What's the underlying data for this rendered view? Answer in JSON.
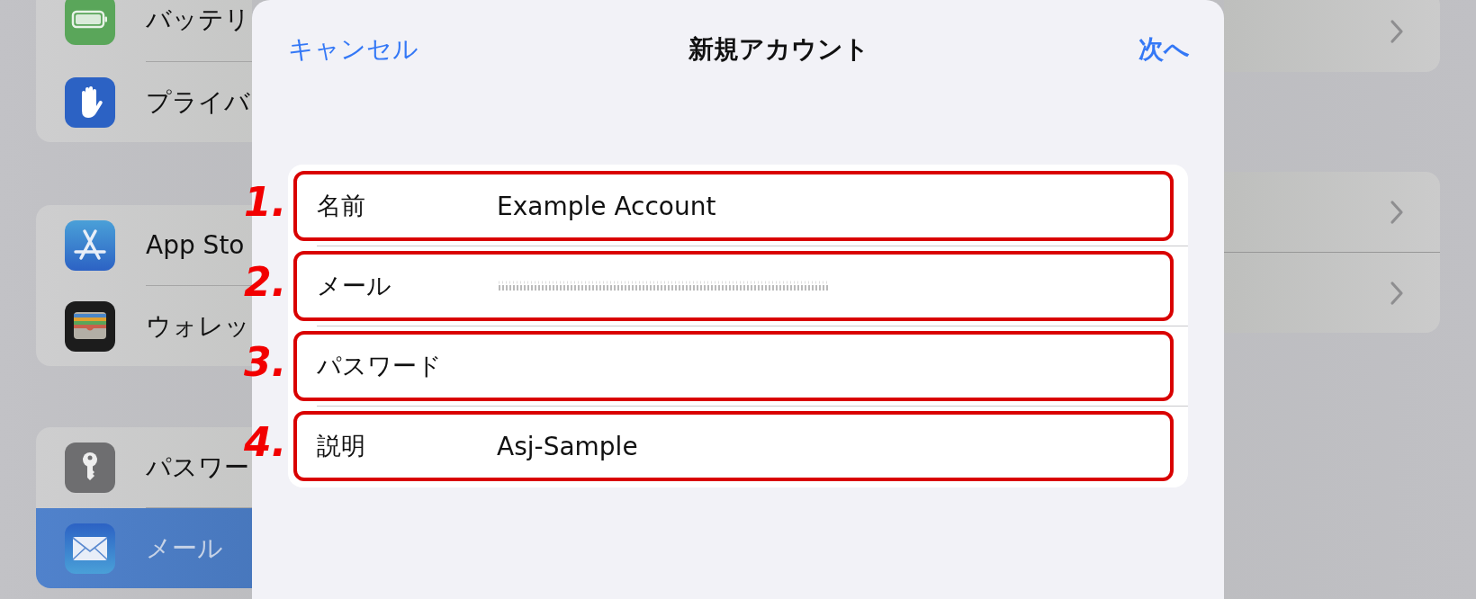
{
  "sidebar": {
    "groups": [
      {
        "items": [
          {
            "kind": "battery",
            "label": "バッテリ",
            "selected": false
          },
          {
            "kind": "privacy",
            "label": "プライバ",
            "selected": false
          }
        ]
      },
      {
        "items": [
          {
            "kind": "appstore",
            "label": "App Sto",
            "selected": false
          },
          {
            "kind": "wallet",
            "label": "ウォレッ",
            "selected": false
          }
        ]
      },
      {
        "items": [
          {
            "kind": "passwords",
            "label": "パスワー",
            "selected": false
          },
          {
            "kind": "mail",
            "label": "メール",
            "selected": true
          }
        ]
      }
    ]
  },
  "sheet": {
    "cancel": "キャンセル",
    "title": "新規アカウント",
    "next": "次へ",
    "fields": [
      {
        "marker": "1.",
        "label": "名前",
        "value": "Example Account",
        "redacted": false
      },
      {
        "marker": "2.",
        "label": "メール",
        "redacted": true
      },
      {
        "marker": "3.",
        "label": "パスワード",
        "redacted": false
      },
      {
        "marker": "4.",
        "label": "説明",
        "value": "Asj-Sample",
        "redacted": false
      }
    ]
  }
}
